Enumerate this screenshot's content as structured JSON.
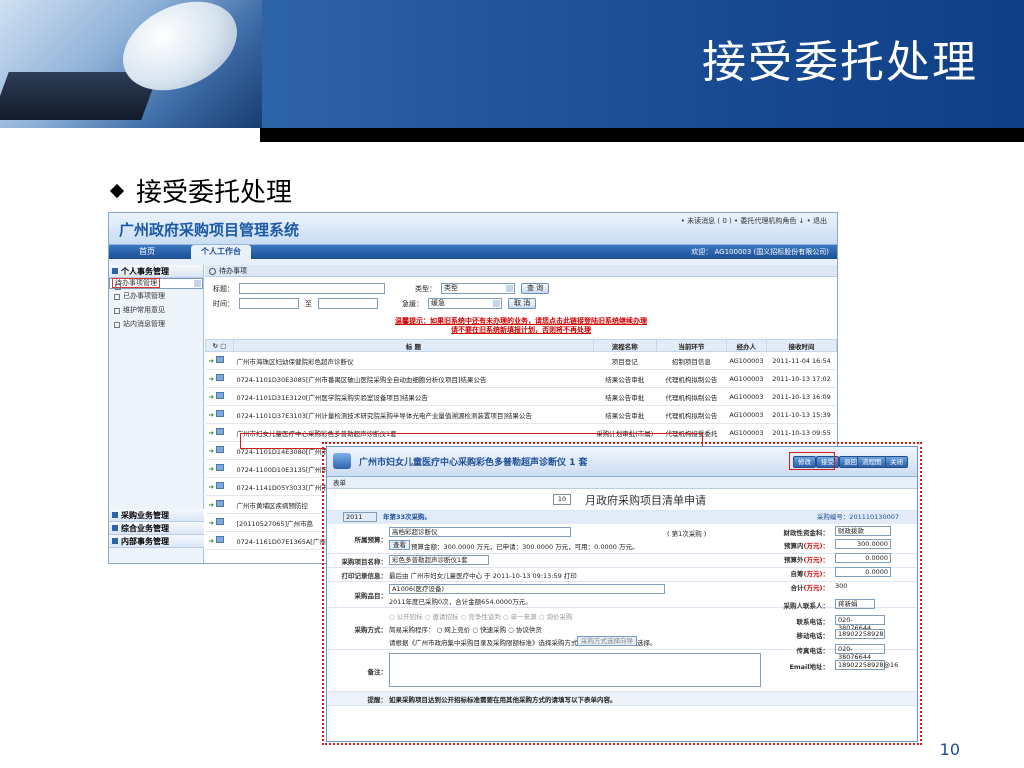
{
  "slide": {
    "title": "接受委托处理",
    "bullet": "接受委托处理",
    "page_number": "10"
  },
  "app": {
    "system_title": "广州政府采购项目管理系统",
    "top_links": "• 未读消息 ( 0 )    • 委托代理机构角色 ↓    • 退出",
    "nav_home": "首页",
    "nav_workbench": "个人工作台",
    "welcome": "欢迎： AG100003 (国义招标股份有限公司)"
  },
  "sidebar": {
    "group1": "个人事务管理",
    "items": [
      "待办事项管理",
      "已办事项管理",
      "维护常用意见",
      "站内消息管理"
    ],
    "bottom_groups": [
      "采购业务管理",
      "综合业务管理",
      "内部事务管理"
    ]
  },
  "main": {
    "section": "待办事项",
    "title_label": "标题：",
    "time_label": "时间：",
    "to_label": "至",
    "type_label": "类型：",
    "type_value": "类型",
    "urgency_label": "急缓：",
    "urgency_value": "缓急",
    "query_button": "查 询",
    "cancel_button": "取 消",
    "warning1": "温馨提示：如果旧系统中还有未办理的业务，请您点击此链接登陆旧系统继续办理",
    "warning2": "请不要在旧系统新填报计划，否则将不再处理",
    "columns": [
      "标 题",
      "流程名称",
      "当前环节",
      "经办人",
      "接收时间"
    ],
    "rows": [
      {
        "title": "广州市海珠区妇幼保健院彩色超声诊断仪",
        "flow": "项目登记",
        "step": "招制项目信息",
        "handler": "AG100003",
        "time": "2011-11-04 16:54"
      },
      {
        "title": "0724-1101D30E3085[广州市番禺区破山医院采购全自动血细胞分析仪项目]结果公告",
        "flow": "结果公告审批",
        "step": "代理机构拟制公告",
        "handler": "AG100003",
        "time": "2011-10-13 17:02"
      },
      {
        "title": "0724-1101D31E3120[广州医学院采购实验室设备项目]结果公告",
        "flow": "结果公告审批",
        "step": "代理机构拟制公告",
        "handler": "AG100003",
        "time": "2011-10-13 16:09"
      },
      {
        "title": "0724-1101D37E3103[广州计量检测技术研究院采购半导体光电产业量值溯源检测装置项目]结果公告",
        "flow": "结果公告审批",
        "step": "代理机构拟制公告",
        "handler": "AG100003",
        "time": "2011-10-13 15:39"
      },
      {
        "title": "广州市妇女儿童医疗中心采购彩色多普勒超声诊断仪1套",
        "flow": "采购计划审批(市属)",
        "step": "代理机构接受委托",
        "handler": "AG100003",
        "time": "2011-10-13 09:55"
      },
      {
        "title": "0724-1101D14E3080[广州市",
        "flow": "",
        "step": "",
        "handler": "",
        "time": ""
      },
      {
        "title": "0724-1100D10E3135[广州市",
        "flow": "",
        "step": "",
        "handler": "",
        "time": ""
      },
      {
        "title": "0724-1141D05Y3033[广州市",
        "flow": "",
        "step": "",
        "handler": "",
        "time": ""
      },
      {
        "title": "广州市黄埔区疾病预防控",
        "flow": "",
        "step": "",
        "handler": "",
        "time": ""
      },
      {
        "title": "[20110527065]广州市荔",
        "flow": "",
        "step": "",
        "handler": "",
        "time": ""
      },
      {
        "title": "0724-1161D07E1365A[广州",
        "flow": "",
        "step": "",
        "handler": "",
        "time": ""
      }
    ]
  },
  "popup": {
    "title": "广州市妇女儿童医疗中心采购彩色多普勒超声诊断仪 1 套",
    "buttons": [
      "修改",
      "接受",
      "退回",
      "流程图",
      "关闭"
    ],
    "sub": "表单",
    "year_num": "10",
    "heading": "月政府采购项目清单申请",
    "year_select": "2011",
    "year_note": "年第33次采购。",
    "serial": "采购编号：201110130007",
    "project_budget_label": "所属预算：",
    "budget_name": "高档彩超诊断仪",
    "budget_note": "( 第1次采购 )",
    "budget_btn": "查看",
    "budget_detail": "预算金额：300.0000 万元，已申请：300.0000 万元，可用：0.0000 万元。",
    "name_label": "采购项目名称：",
    "name_value": "彩色多普勒超声诊断仪1套",
    "print_label": "打印记录信息：",
    "print_value": "最后由 广州市妇女儿童医疗中心 于 2011-10-13 09:13:59 打印",
    "items_label": "采购品目：",
    "items_value": "A1006(医疗设备)",
    "items_note": "2011年度已采购0次，合计金额654.0000万元。",
    "method_label": "采购方式：",
    "methods": "○ 公开招标  ○ 邀请招标  ○ 竞争性谈判  ○ 单一来源  ○ 询价采购",
    "procedure": "简易采购程序：  ○ 网上竞价  ○ 快速采购  ○ 协议供货",
    "method_hint": "请根据《广州市政府集中采购目录及采购限额标准》选择采购方式，或使用",
    "method_btn": "采购方式选择向导",
    "method_hint2": "选择。",
    "remark_label": "备注：",
    "tip_label": "提醒：",
    "tip_value": "如果采购项目达到公开招标标准需要在用其他采购方式的请填写以下表单内容。",
    "right": {
      "fund_label": "财政性资金科：",
      "fund_value": "财政拨款",
      "in_budget_label": "预算内",
      "in_budget_value": "300.0000",
      "out_budget_label": "预算外",
      "out_budget_value": "0.0000",
      "self_label": "自筹",
      "self_value": "0.0000",
      "total_label": "合计",
      "total_value": "300",
      "contact_label": "采购人联系人：",
      "contact_value": "蒋新娟",
      "phone_label": "联系电话：",
      "phone_value": "020-38076644",
      "mobile_label": "移动电话：",
      "mobile_value": "18902258928",
      "fax_label": "传真电话：",
      "fax_value": "020-38076644",
      "email_label": "Email地址：",
      "email_value": "18902258928@16",
      "unit": "(万元)：",
      "unit_total": "(万元)："
    }
  },
  "colors": {
    "header_blue": "#1a4e95",
    "highlight_red": "#d21b1b",
    "warning_red": "#d20000"
  }
}
